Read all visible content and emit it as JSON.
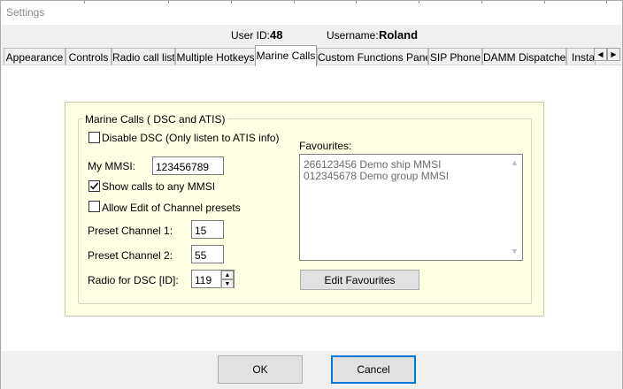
{
  "window": {
    "title": "Settings"
  },
  "user": {
    "id_label": "User ID:",
    "id_value": "48",
    "username_label": "Username:",
    "username_value": "Roland"
  },
  "tabs": [
    {
      "label": "Appearance",
      "active": false
    },
    {
      "label": "Controls",
      "active": false
    },
    {
      "label": "Radio call list",
      "active": false
    },
    {
      "label": "Multiple Hotkeys",
      "active": false
    },
    {
      "label": "Marine Calls",
      "active": true
    },
    {
      "label": "Custom Functions Panel",
      "active": false
    },
    {
      "label": "SIP Phone",
      "active": false
    },
    {
      "label": "DAMM Dispatcher",
      "active": false
    },
    {
      "label": "Insta",
      "active": false
    }
  ],
  "marine": {
    "group_title": "Marine Calls ( DSC and ATIS)",
    "disable_dsc": {
      "label": "Disable DSC (Only listen to ATIS info)",
      "checked": false
    },
    "my_mmsi_label": "My MMSI:",
    "my_mmsi_value": "123456789",
    "show_calls": {
      "label": "Show calls to any MMSI",
      "checked": true
    },
    "allow_edit": {
      "label": "Allow Edit of Channel presets",
      "checked": false
    },
    "preset1_label": "Preset Channel 1:",
    "preset1_value": "15",
    "preset2_label": "Preset Channel 2:",
    "preset2_value": "55",
    "radio_dsc_label": "Radio for DSC [ID]:",
    "radio_dsc_value": "119",
    "favourites_label": "Favourites:",
    "favourites": [
      "266123456 Demo ship MMSI",
      "012345678 Demo group MMSI"
    ],
    "edit_favourites_label": "Edit Favourites"
  },
  "buttons": {
    "ok_label": "OK",
    "cancel_label": "Cancel"
  },
  "colors": {
    "group_background": "#ffffe4",
    "focus_border": "#0078d7"
  }
}
